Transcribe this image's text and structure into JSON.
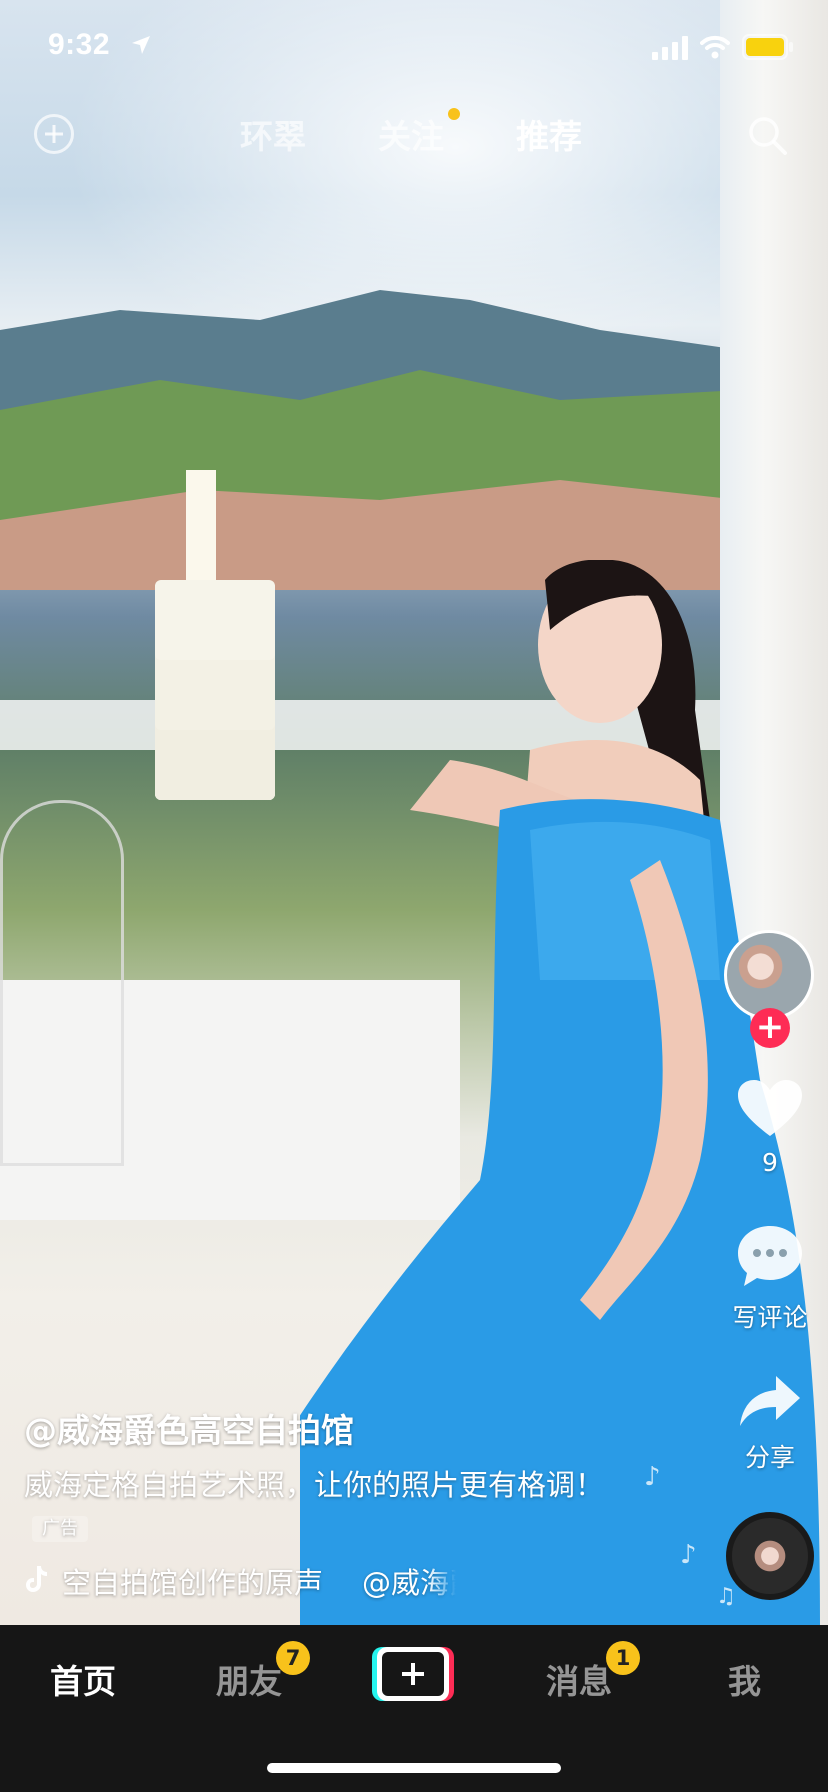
{
  "status_bar": {
    "time": "9:32"
  },
  "top_tabs": {
    "items": [
      {
        "label": "环翠",
        "active": false
      },
      {
        "label": "关注",
        "active": false,
        "dot": true
      },
      {
        "label": "推荐",
        "active": true
      }
    ]
  },
  "actions": {
    "likes_count": "9",
    "comment_label": "写评论",
    "share_label": "分享"
  },
  "caption": {
    "author": "@威海爵色高空自拍馆",
    "description": "威海定格自拍艺术照，让你的照片更有格调！",
    "ad_tag": "广告",
    "music_title": "空自拍馆创作的原声",
    "music_author": "@威海爵色高空自拍馆"
  },
  "bottom_nav": {
    "home": "首页",
    "friends": "朋友",
    "friends_badge": "7",
    "messages": "消息",
    "messages_badge": "1",
    "me": "我"
  },
  "colors": {
    "accent_red": "#fe2c55",
    "accent_cyan": "#25f4ee",
    "badge_yellow": "#f8c21b",
    "nav_background": "#161616",
    "dress_blue": "#2a9be6"
  }
}
